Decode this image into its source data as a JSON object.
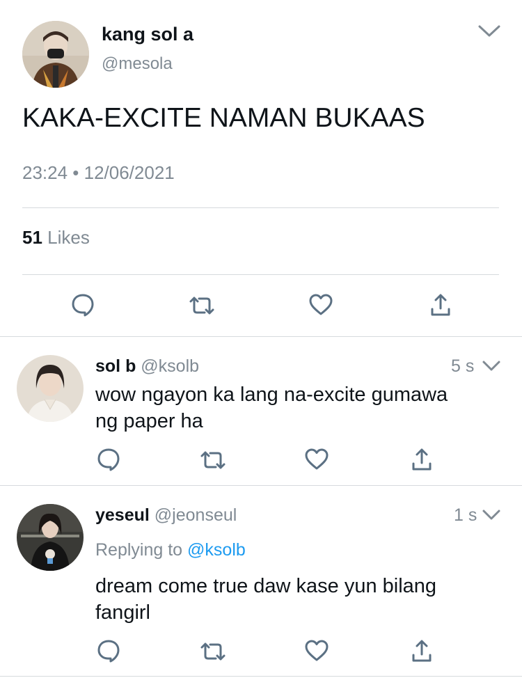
{
  "main_tweet": {
    "display_name": "kang sol a",
    "handle": "@mesola",
    "text": "KAKA-EXCITE NAMAN BUKAAS",
    "timestamp": "23:24 • 12/06/2021",
    "likes_count": "51",
    "likes_label": "Likes"
  },
  "replies": [
    {
      "display_name": "sol b",
      "handle": "@ksolb",
      "time": "5 s",
      "text_lines": [
        "wow ngayon ka lang na-excite gumawa",
        "ng paper ha"
      ]
    },
    {
      "display_name": "yeseul",
      "handle": "@jeonseul",
      "time": "1 s",
      "replying_prefix": "Replying to",
      "replying_to": "@ksolb",
      "text_lines": [
        "dream come true daw kase yun bilang",
        "fangirl"
      ]
    }
  ],
  "icons": {
    "reply": "reply-icon",
    "retweet": "retweet-icon",
    "like": "heart-icon",
    "share": "share-icon",
    "more": "chevron-down-icon"
  },
  "colors": {
    "text": "#0f1419",
    "secondary": "#808a93",
    "link": "#1d9bf0",
    "divider": "#d6dadd",
    "icon": "#5b7083"
  }
}
